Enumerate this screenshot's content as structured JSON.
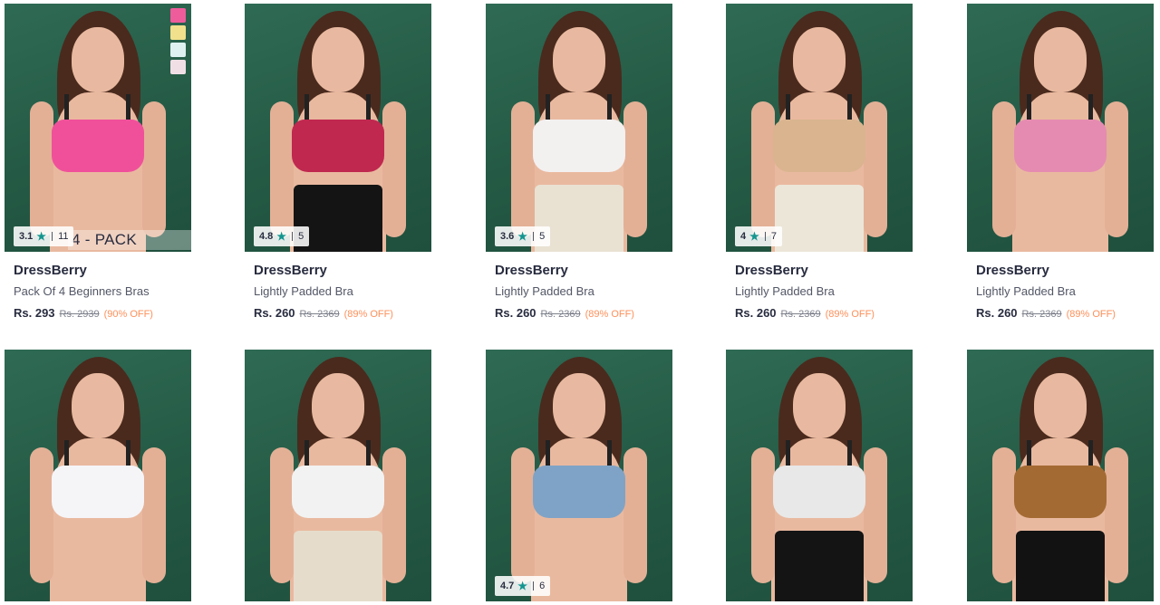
{
  "colors": {
    "rating_star": "#14958f",
    "discount": "#ff905a",
    "background": "#2a6450"
  },
  "products": [
    {
      "brand": "DressBerry",
      "name": "Pack Of 4 Beginners Bras",
      "price": "Rs. 293",
      "mrp": "Rs. 2939",
      "discount": "(90% OFF)",
      "rating": {
        "value": "3.1",
        "count": "11",
        "star_icon": "★"
      },
      "overlay_label": "4 - PACK",
      "swatches": [
        "#ee5c9b",
        "#f1e08c",
        "#dff1f1",
        "#f1dfe6"
      ],
      "top_color": "#f0509a",
      "bottom_color": "#e9b99f"
    },
    {
      "brand": "DressBerry",
      "name": "Lightly Padded Bra",
      "price": "Rs. 260",
      "mrp": "Rs. 2369",
      "discount": "(89% OFF)",
      "rating": {
        "value": "4.8",
        "count": "5",
        "star_icon": "★"
      },
      "top_color": "#c0284f",
      "bottom_color": "#141414"
    },
    {
      "brand": "DressBerry",
      "name": "Lightly Padded Bra",
      "price": "Rs. 260",
      "mrp": "Rs. 2369",
      "discount": "(89% OFF)",
      "rating": {
        "value": "3.6",
        "count": "5",
        "star_icon": "★"
      },
      "top_color": "#f3f0f0",
      "bottom_color": "#e9e2d3"
    },
    {
      "brand": "DressBerry",
      "name": "Lightly Padded Bra",
      "price": "Rs. 260",
      "mrp": "Rs. 2369",
      "discount": "(89% OFF)",
      "rating": {
        "value": "4",
        "count": "7",
        "star_icon": "★"
      },
      "top_color": "#d9b48f",
      "bottom_color": "#ece6d8"
    },
    {
      "brand": "DressBerry",
      "name": "Lightly Padded Bra",
      "price": "Rs. 260",
      "mrp": "Rs. 2369",
      "discount": "(89% OFF)",
      "top_color": "#e58bb1",
      "bottom_color": "#e9b99f"
    },
    {
      "top_color": "#f5f5f8",
      "bottom_color": "#e9b99f"
    },
    {
      "top_color": "#f2f2f2",
      "bottom_color": "#e6dccb"
    },
    {
      "rating": {
        "value": "4.7",
        "count": "6",
        "star_icon": "★"
      },
      "top_color": "#7fa3c6",
      "bottom_color": "#e9b99f"
    },
    {
      "top_color": "#e8e8e8",
      "bottom_color": "#141414"
    },
    {
      "top_color": "#a36a33",
      "bottom_color": "#121212"
    }
  ]
}
